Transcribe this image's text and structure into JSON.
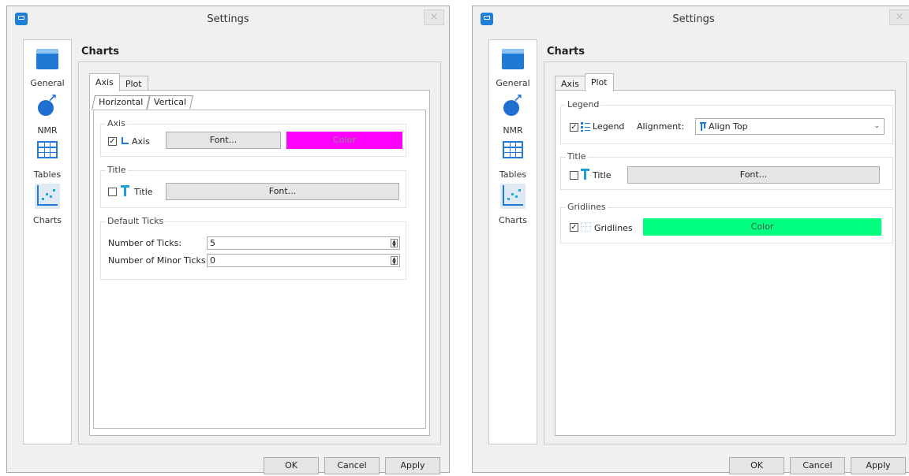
{
  "windows": [
    {
      "title": "Settings",
      "sidebar": [
        "General",
        "NMR",
        "Tables",
        "Charts"
      ],
      "heading": "Charts",
      "tabs": [
        "Axis",
        "Plot"
      ],
      "subtabs": [
        "Horizontal",
        "Vertical"
      ],
      "axis_group": {
        "title": "Axis",
        "checkbox_label": "Axis",
        "font_button": "Font...",
        "color_button": "Color",
        "color": "#ff00ff"
      },
      "title_group": {
        "title": "Title",
        "checkbox_label": "Title",
        "font_button": "Font..."
      },
      "ticks_group": {
        "title": "Default Ticks",
        "num_ticks_label": "Number of Ticks:",
        "num_ticks_value": "5",
        "minor_ticks_label": "Number of Minor Ticks:",
        "minor_ticks_value": "0"
      },
      "buttons": {
        "ok": "OK",
        "cancel": "Cancel",
        "apply": "Apply"
      }
    },
    {
      "title": "Settings",
      "sidebar": [
        "General",
        "NMR",
        "Tables",
        "Charts"
      ],
      "heading": "Charts",
      "tabs": [
        "Axis",
        "Plot"
      ],
      "legend_group": {
        "title": "Legend",
        "checkbox_label": "Legend",
        "alignment_label": "Alignment:",
        "alignment_value": "Align Top"
      },
      "title_group": {
        "title": "Title",
        "checkbox_label": "Title",
        "font_button": "Font..."
      },
      "gridlines_group": {
        "title": "Gridlines",
        "checkbox_label": "Gridlines",
        "color_button": "Color",
        "color": "#00ff7f"
      },
      "buttons": {
        "ok": "OK",
        "cancel": "Cancel",
        "apply": "Apply"
      }
    }
  ],
  "icons": {
    "general": "window-icon",
    "nmr": "molecule-icon",
    "tables": "table-icon",
    "charts": "scatter-chart-icon",
    "app": "app-icon",
    "close": "close-icon"
  },
  "colors": {
    "accent": "#1f7ad6",
    "axis_color": "#ff00ff",
    "gridlines_color": "#00ff7f"
  },
  "glyphs": {
    "check": "✓",
    "close": "×"
  }
}
